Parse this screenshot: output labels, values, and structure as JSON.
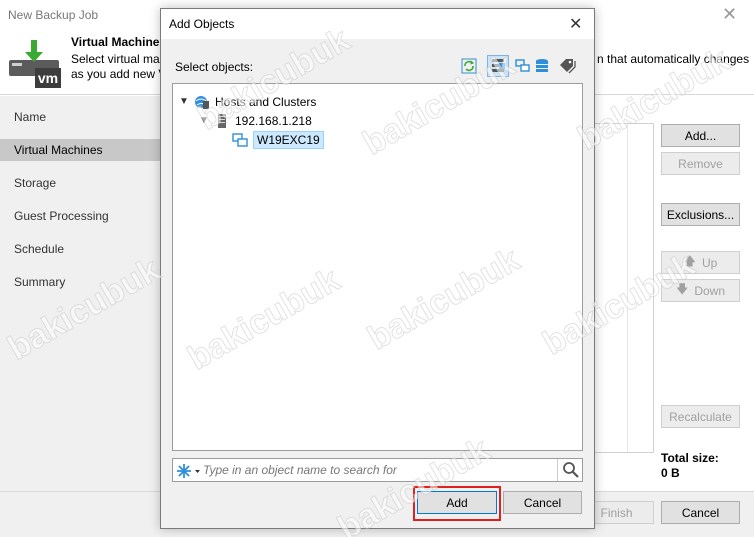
{
  "wizard": {
    "title": "New Backup Job",
    "header_title": "Virtual Machines",
    "header_desc_line1": "Select virtual ma",
    "header_desc_line2": "as you add new V",
    "header_desc_right": "n that automatically changes",
    "logo_text": "vm",
    "nav": [
      {
        "label": "Name",
        "active": false
      },
      {
        "label": "Virtual Machines",
        "active": true
      },
      {
        "label": "Storage",
        "active": false
      },
      {
        "label": "Guest Processing",
        "active": false
      },
      {
        "label": "Schedule",
        "active": false
      },
      {
        "label": "Summary",
        "active": false
      }
    ],
    "buttons": {
      "add": "Add...",
      "remove": "Remove",
      "exclusions": "Exclusions...",
      "up": "Up",
      "down": "Down",
      "recalculate": "Recalculate",
      "finish": "Finish",
      "cancel": "Cancel"
    },
    "total_size_label": "Total size:",
    "total_size_value": "0 B"
  },
  "dialog": {
    "title": "Add Objects",
    "select_label": "Select objects:",
    "toolbar_icons": [
      "refresh-icon",
      "hosts-and-clusters-view-icon",
      "vms-and-templates-view-icon",
      "datastores-view-icon",
      "tags-view-icon"
    ],
    "tree": [
      {
        "label": "Hosts and Clusters",
        "level": 0,
        "expanded": true,
        "icon": "hosts-and-clusters-icon",
        "selected": false
      },
      {
        "label": "192.168.1.218",
        "level": 1,
        "expanded": true,
        "icon": "host-server-icon",
        "selected": false
      },
      {
        "label": "W19EXC19",
        "level": 2,
        "expanded": false,
        "icon": "vm-icon",
        "selected": true
      }
    ],
    "search": {
      "placeholder": "Type in an object name to search for",
      "value": ""
    },
    "buttons": {
      "add": "Add",
      "cancel": "Cancel"
    }
  },
  "watermark": "bakicubuk",
  "colors": {
    "selection_bg": "#cce8ff",
    "nav_active_bg": "#c8c8c8",
    "highlight_box": "#e0201b",
    "veeam_green": "#3aaa35"
  }
}
